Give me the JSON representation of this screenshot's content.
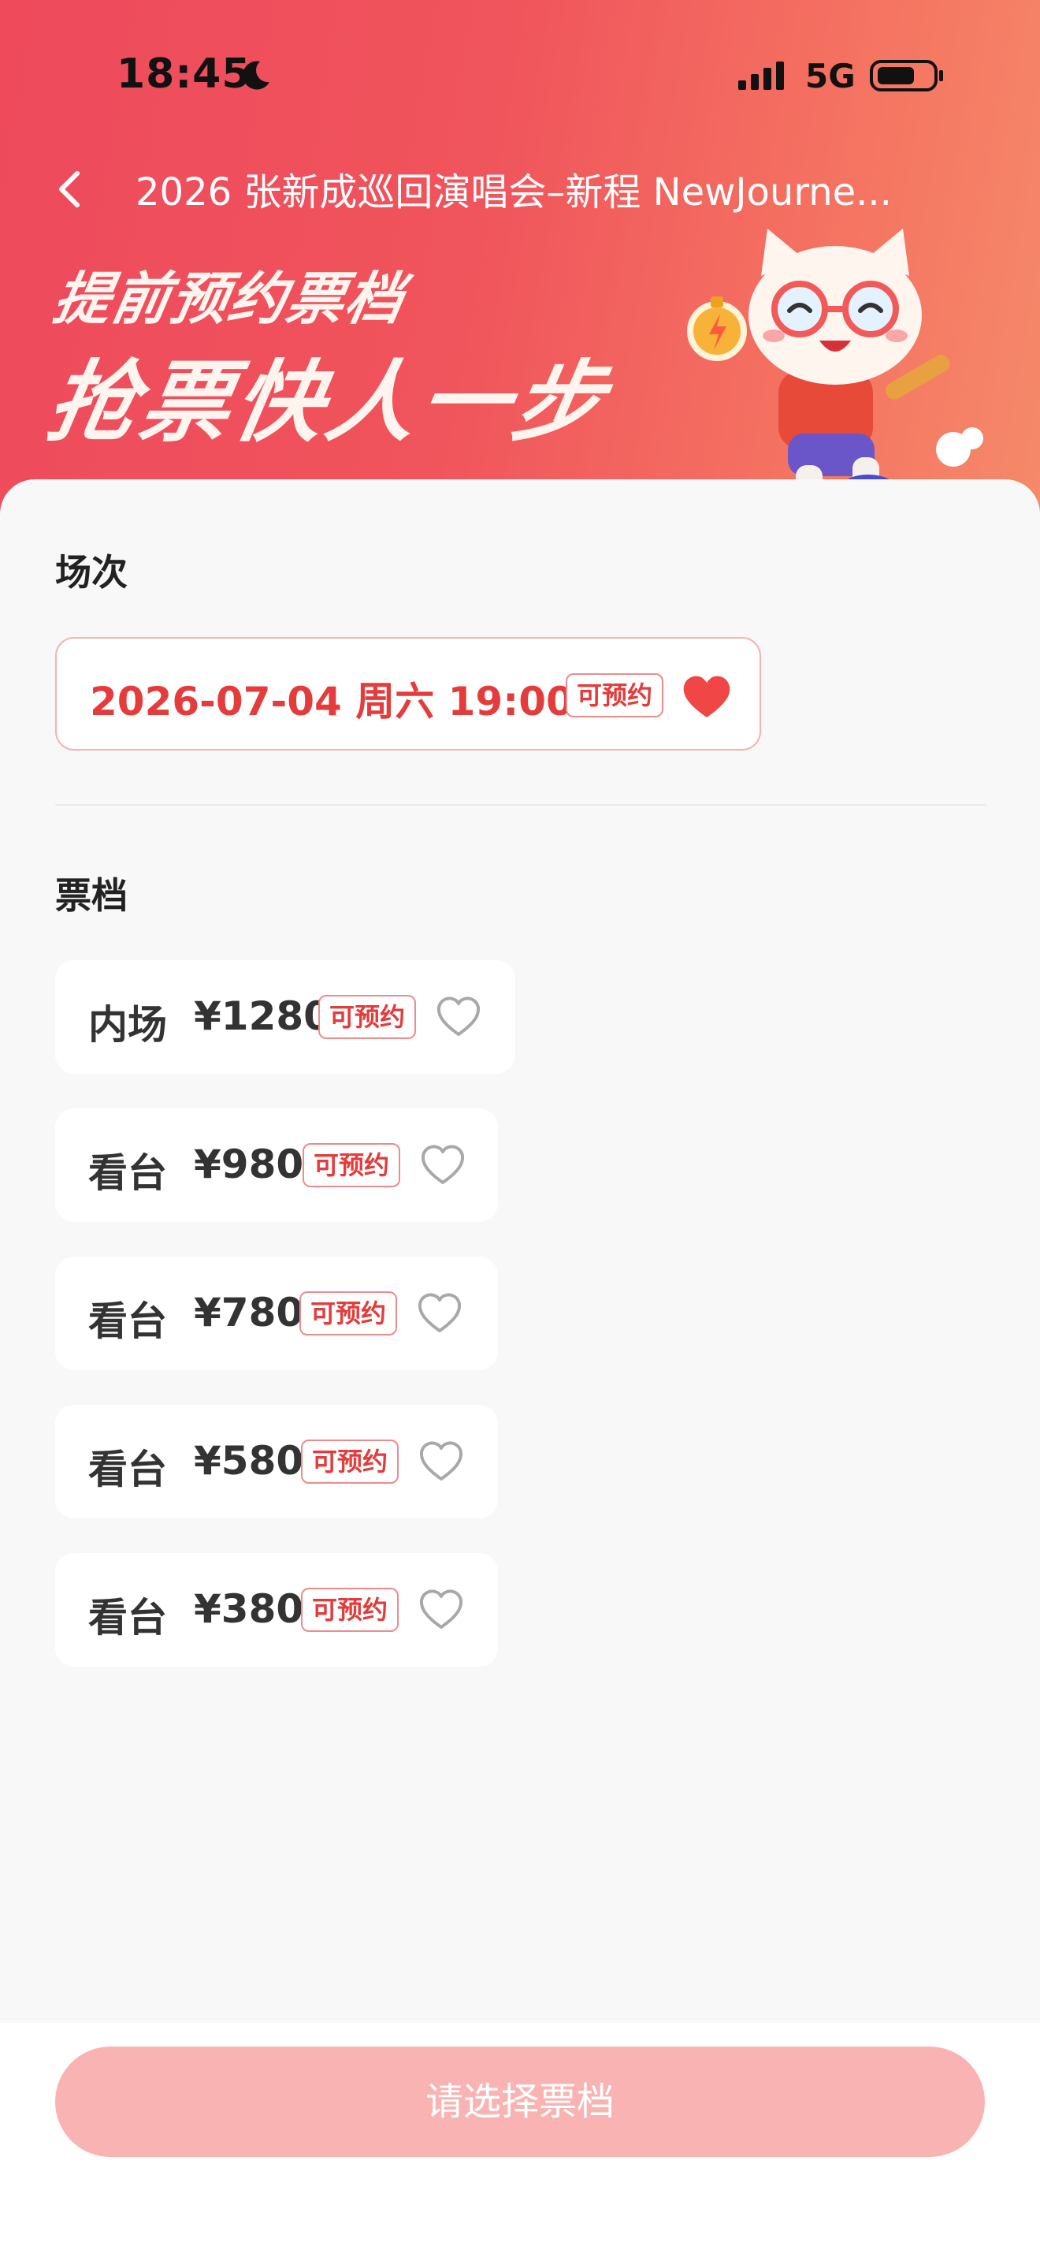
{
  "status_bar": {
    "time": "18:45",
    "network": "5G"
  },
  "nav": {
    "title": "2026 张新成巡回演唱会–新程 NewJourne..."
  },
  "promo": {
    "line1": "提前预约票档",
    "line2": "抢票快人一步"
  },
  "session": {
    "label": "场次",
    "card": {
      "text": "2026-07-04 周六 19:00",
      "tag": "可预约",
      "favorited": true
    }
  },
  "tickets": {
    "label": "票档",
    "items": [
      {
        "area": "内场",
        "price": "¥1280",
        "tag": "可预约",
        "favorited": false
      },
      {
        "area": "看台",
        "price": "¥980",
        "tag": "可预约",
        "favorited": false
      },
      {
        "area": "看台",
        "price": "¥780",
        "tag": "可预约",
        "favorited": false
      },
      {
        "area": "看台",
        "price": "¥580",
        "tag": "可预约",
        "favorited": false
      },
      {
        "area": "看台",
        "price": "¥380",
        "tag": "可预约",
        "favorited": false
      }
    ]
  },
  "bottom": {
    "button_label": "请选择票档"
  },
  "colors": {
    "accent": "#e43c3c",
    "button": "#f9b3b3",
    "hero_start": "#ee4a5c",
    "hero_end": "#f58a6a"
  },
  "icons": [
    "moon-icon",
    "signal-icon",
    "battery-icon",
    "back-icon",
    "heart-filled-icon",
    "heart-outline-icon",
    "mascot-icon"
  ]
}
